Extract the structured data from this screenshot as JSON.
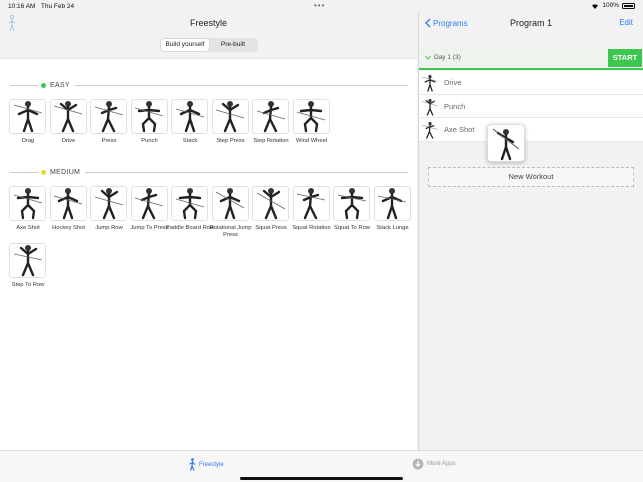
{
  "status": {
    "time": "10:16 AM",
    "date": "Thu Feb 24",
    "battery": "100%"
  },
  "left": {
    "title": "Freestyle",
    "segments": [
      {
        "label": "Build yourself",
        "active": true
      },
      {
        "label": "Pre-built",
        "active": false
      }
    ],
    "sections": [
      {
        "label": "EASY",
        "dot_color": "#3ec74f",
        "items": [
          "Drag",
          "Drive",
          "Press",
          "Punch",
          "Stack",
          "Step Press",
          "Step Rotation",
          "Wind Wheel"
        ]
      },
      {
        "label": "MEDIUM",
        "dot_color": "#e6d43a",
        "items": [
          "Axe Shot",
          "Hockey Shot",
          "Jump Row",
          "Jump To Press",
          "Paddle Board Row",
          "Rotational Jump Press",
          "Squat Press",
          "Squat Rotation",
          "Squat To Row",
          "Stack Lunge",
          "Step To Row"
        ]
      }
    ]
  },
  "right": {
    "back_label": "Programs",
    "title": "Program 1",
    "edit_label": "Edit",
    "day_label": "Day 1 (3)",
    "start_label": "START",
    "exercises": [
      "Drive",
      "Punch",
      "Axe Shot"
    ],
    "new_workout_label": "New Workout"
  },
  "tabbar": {
    "freestyle_label": "Freestyle",
    "more_label": "More Apps"
  },
  "colors": {
    "accent": "#2f7bf5",
    "start_green": "#3ec74f",
    "easy_dot": "#3ec74f",
    "medium_dot": "#e6d43a"
  }
}
